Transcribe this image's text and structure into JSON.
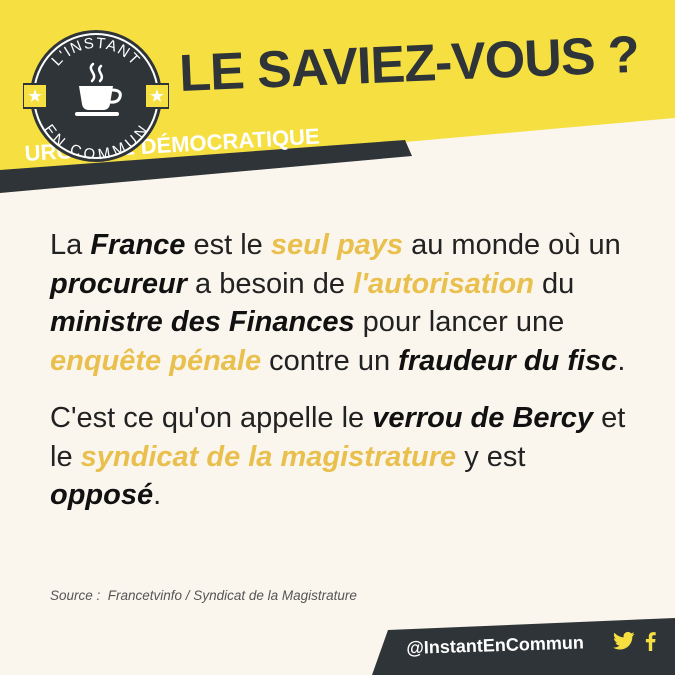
{
  "logo": {
    "top_text": "L'INSTANT",
    "bottom_text": "EN COMMUN"
  },
  "headline": "LE SAVIEZ-VOUS ?",
  "tag": "URGENCE DÉMOCRATIQUE",
  "paragraph1": {
    "t1": "La ",
    "k1": "France",
    "t2": " est le ",
    "h1": "seul pays",
    "t3": " au monde où un ",
    "k2": "procureur",
    "t4": " a besoin de ",
    "h2": "l'autorisation",
    "t5": " du ",
    "k3": "ministre des Finances",
    "t6": " pour lancer une ",
    "h3": "enquête pénale",
    "t7": " contre un ",
    "k4": "fraudeur du fisc",
    "t8": "."
  },
  "paragraph2": {
    "t1": "C'est ce qu'on appelle le ",
    "k1": "verrou de Bercy",
    "t2": " et le ",
    "h1": "syndicat de la magistrature",
    "t3": " y est ",
    "k2": "opposé",
    "t4": "."
  },
  "source": "Source :  Francetvinfo / Syndicat de la Magistrature",
  "footer": {
    "handle": "@InstantEnCommun",
    "icons": [
      "twitter-icon",
      "facebook-icon"
    ]
  },
  "colors": {
    "yellow": "#f6df40",
    "dark": "#2f3438",
    "highlight": "#e9c04d",
    "background": "#faf6ee"
  }
}
